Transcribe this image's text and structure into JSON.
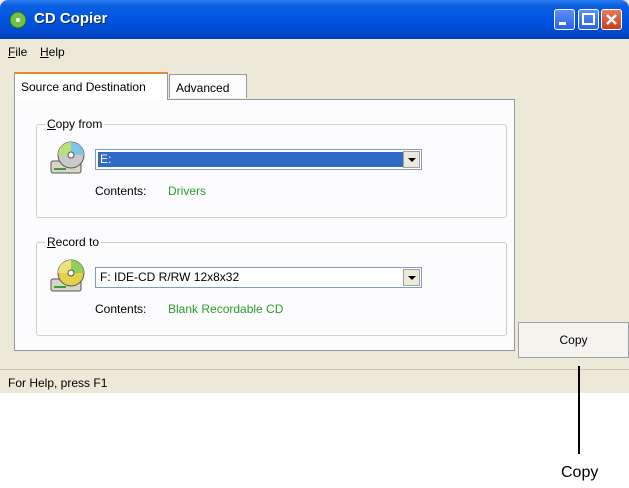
{
  "window": {
    "title": "CD Copier",
    "icon": "cd-copier-app-icon"
  },
  "menu": {
    "items": [
      "File",
      "Help"
    ]
  },
  "tabs": [
    {
      "label": "Source and Destination",
      "active": true
    },
    {
      "label": "Advanced",
      "active": false
    }
  ],
  "copy_from": {
    "legend": "Copy from",
    "icon": "cd-drive-icon",
    "drive": "E:",
    "contents_label": "Contents:",
    "contents_value": "Drivers"
  },
  "record_to": {
    "legend": "Record to",
    "icon": "cd-writer-icon",
    "drive": "F: IDE-CD R/RW 12x8x32",
    "contents_label": "Contents:",
    "contents_value": "Blank Recordable CD"
  },
  "buttons": {
    "copy": "Copy"
  },
  "status": {
    "text": "For Help, press F1"
  },
  "callout": {
    "label": "Copy"
  },
  "colors": {
    "title_bar": "#0054e3",
    "contents_value": "#2c9c2c",
    "selection": "#316ac5"
  }
}
